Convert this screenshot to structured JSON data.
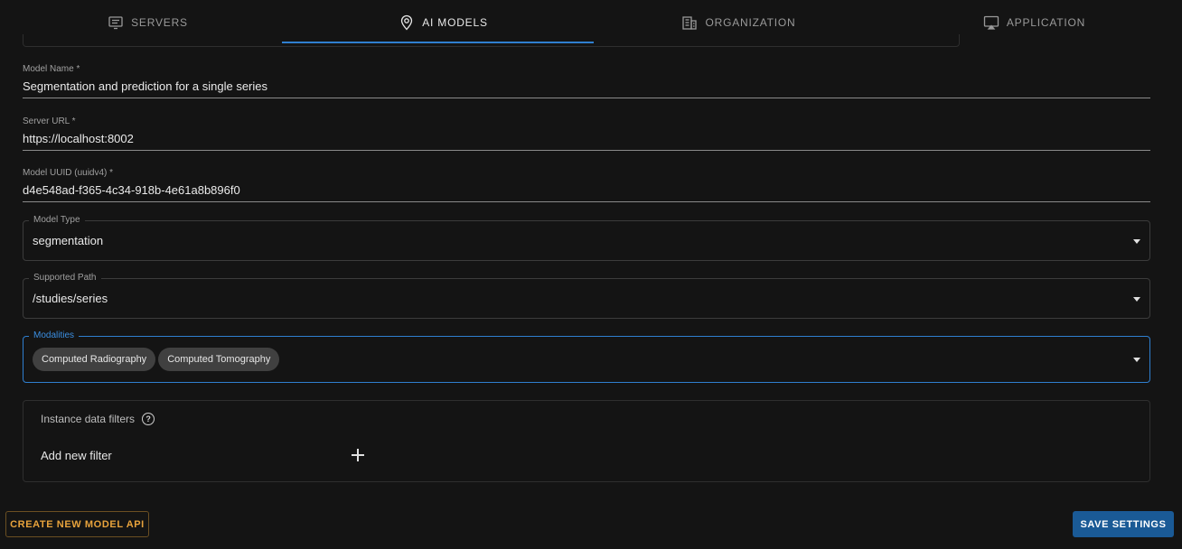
{
  "tabs": [
    {
      "label": "SERVERS",
      "icon": "monitor-icon",
      "active": false
    },
    {
      "label": "AI MODELS",
      "icon": "brain-pin-icon",
      "active": true
    },
    {
      "label": "ORGANIZATION",
      "icon": "building-icon",
      "active": false
    },
    {
      "label": "APPLICATION",
      "icon": "desktop-icon",
      "active": false
    }
  ],
  "form": {
    "model_name": {
      "label": "Model Name *",
      "value": "Segmentation and prediction for a single series"
    },
    "server_url": {
      "label": "Server URL *",
      "value": "https://localhost:8002"
    },
    "model_uuid": {
      "label": "Model UUID (uuidv4) *",
      "value": "d4e548ad-f365-4c34-918b-4e61a8b896f0"
    },
    "model_type": {
      "label": "Model Type",
      "value": "segmentation"
    },
    "supported_path": {
      "label": "Supported Path",
      "value": "/studies/series"
    },
    "modalities": {
      "label": "Modalities",
      "chips": [
        "Computed Radiography",
        "Computed Tomography"
      ]
    }
  },
  "filters": {
    "title": "Instance data filters",
    "help_glyph": "?",
    "add_label": "Add new filter"
  },
  "buttons": {
    "create": "CREATE NEW MODEL API",
    "save": "SAVE SETTINGS"
  },
  "colors": {
    "accent": "#2f7fd0",
    "primary_button": "#1a5a96",
    "outline_button_text": "#e8a33c",
    "background": "#141414"
  }
}
